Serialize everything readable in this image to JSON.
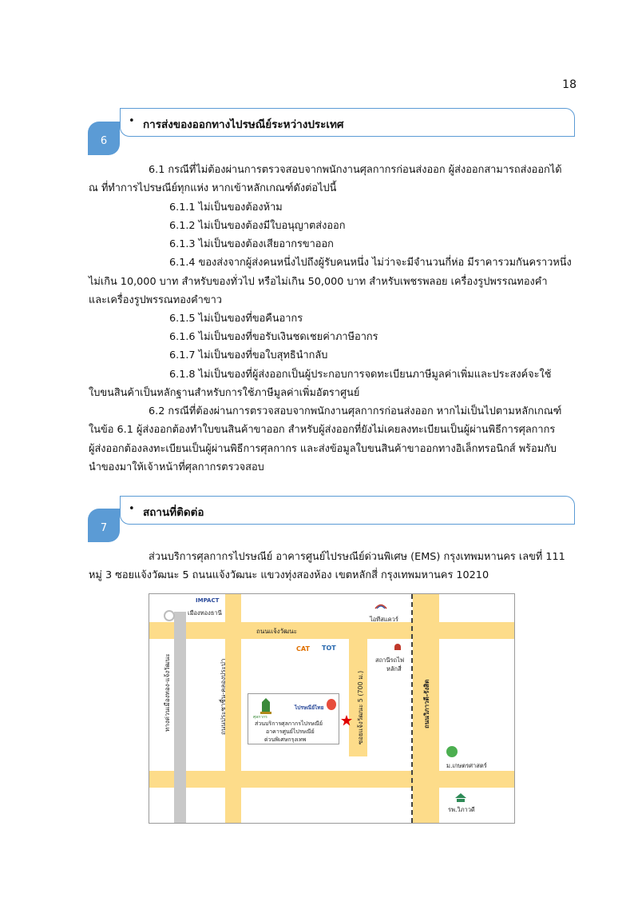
{
  "page_number": "18",
  "section6": {
    "number": "6",
    "bullet": "•",
    "title": "การส่งของออกทางไปรษณีย์ระหว่างประเทศ",
    "lines": [
      "6.1 กรณีที่ไม่ต้องผ่านการตรวจสอบจากพนักงานศุลกากรก่อนส่งออก ผู้ส่งออกสามารถส่งออกได้",
      "ณ ที่ทำการไปรษณีย์ทุกแห่ง หากเข้าหลักเกณฑ์ดังต่อไปนี้",
      "6.1.1 ไม่เป็นของต้องห้าม",
      "6.1.2 ไม่เป็นของต้องมีใบอนุญาตส่งออก",
      "6.1.3 ไม่เป็นของต้องเสียอากรขาออก",
      "6.1.4 ของส่งจากผู้ส่งคนหนึ่งไปถึงผู้รับคนหนึ่ง ไม่ว่าจะมีจำนวนกี่ห่อ มีราคารวมกันคราวหนึ่ง",
      "ไม่เกิน 10,000 บาท สำหรับของทั่วไป หรือไม่เกิน 50,000 บาท  สำหรับเพชรพลอย เครื่องรูปพรรณทองคำ",
      "และเครื่องรูปพรรณทองคำขาว",
      "6.1.5 ไม่เป็นของที่ขอคืนอากร",
      "6.1.6 ไม่เป็นของที่ขอรับเงินชดเชยค่าภาษีอากร",
      "6.1.7 ไม่เป็นของที่ขอใบสุทธินำกลับ",
      "6.1.8 ไม่เป็นของที่ผู้ส่งออกเป็นผู้ประกอบการจดทะเบียนภาษีมูลค่าเพิ่มและประสงค์จะใช้",
      "ใบขนสินค้าเป็นหลักฐานสำหรับการใช้ภาษีมูลค่าเพิ่มอัตราศูนย์",
      "6.2 กรณีที่ต้องผ่านการตรวจสอบจากพนักงานศุลกากรก่อนส่งออก หากไม่เป็นไปตามหลักเกณฑ์",
      "ในข้อ 6.1 ผู้ส่งออกต้องทำใบขนสินค้าขาออก สำหรับผู้ส่งออกที่ยังไม่เคยลงทะเบียนเป็นผู้ผ่านพิธีการศุลกากร",
      "ผู้ส่งออกต้องลงทะเบียนเป็นผู้ผ่านพิธีการศุลกากร และส่งข้อมูลใบขนสินค้าขาออกทางอิเล็กทรอนิกส์ พร้อมกับ",
      "นำของมาให้เจ้าหน้าที่ศุลกากรตรวจสอบ"
    ]
  },
  "section7": {
    "number": "7",
    "bullet": "•",
    "title": "สถานที่ติดต่อ",
    "lines": [
      "ส่วนบริการศุลกากรไปรษณีย์ อาคารศูนย์ไปรษณีย์ด่วนพิเศษ (EMS) กรุงเทพมหานคร เลขที่ 111",
      "หมู่ 3 ซอยแจ้งวัฒนะ 5 ถนนแจ้งวัฒนะ แขวงทุ่งสองห้อง เขตหลักสี่ กรุงเทพมหานคร 10210"
    ]
  },
  "map": {
    "impact_logo": "IMPACT",
    "muang_thong": "เมืองทองธานี",
    "it_square": "ไอทีสแควร์",
    "chaeng_wattana_road": "ถนนแจ้งวัฒนะ",
    "cat_logo": "CAT",
    "tot_logo": "TOT",
    "laksi_station_line1": "สถานีรถไฟ",
    "laksi_station_line2": "หลักสี่",
    "highway_left": "ทางด่วนเมืองทอง-แจ้งวัฒนะ",
    "prachachuen_road": "ถนนประชาชื่น-คลองประปา",
    "soi_chaeng_wattana5": "ซอยแจ้งวัฒนะ 5 (700 ม.)",
    "vibhavadi_road": "ถนนวิภาวดี-รังสิต",
    "customs_logo": "ศุลกากร",
    "thaipost_logo": "ไปรษณีย์ไทย",
    "office_line1": "ส่วนบริการศุลกากรไปรษณีย์",
    "office_line2": "อาคารศูนย์ไปรษณีย์",
    "office_line3": "ด่วนพิเศษกรุงเทพ",
    "kasetsart": "ม.เกษตรศาสตร์",
    "vibhavadi_hospital": "รพ.วิภาวดี",
    "colors": {
      "road": "#fddc8a",
      "highway": "#c8c8c8",
      "accent": "#5b9bd5",
      "marker": "#e00000"
    }
  }
}
